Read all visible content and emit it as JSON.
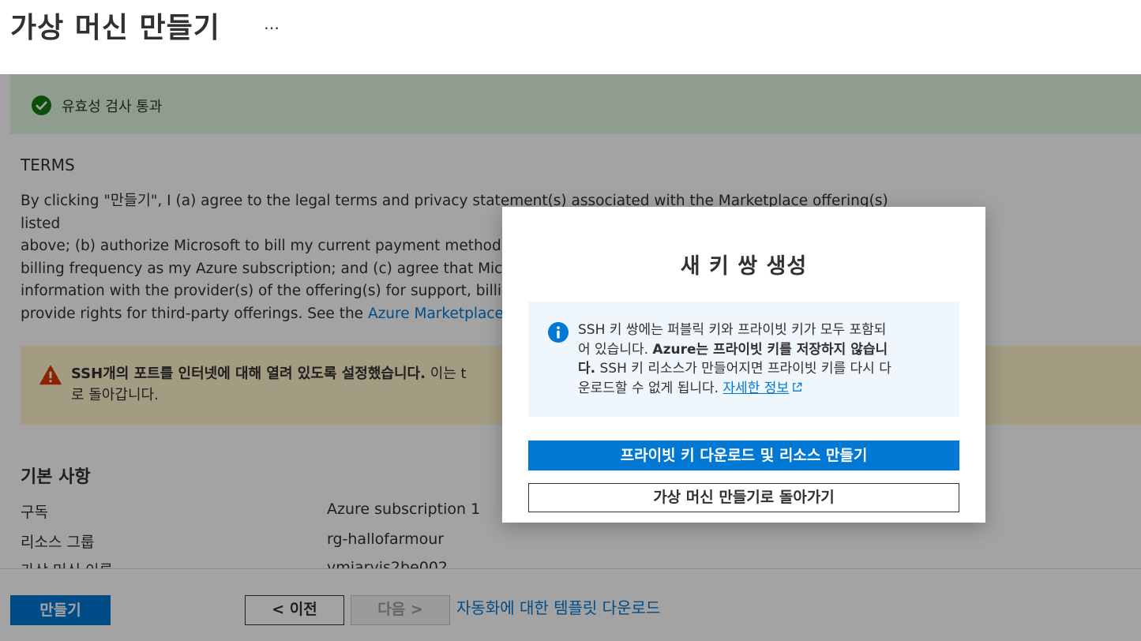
{
  "header": {
    "title": "가상 머신 만들기",
    "more_label": "…"
  },
  "validation": {
    "text": "유효성 검사 통과"
  },
  "terms": {
    "title": "TERMS",
    "line1": "By clicking \"만들기\", I (a) agree to the legal terms and privacy statement(s) associated with the Marketplace offering(s) listed",
    "line2": "above; (b) authorize Microsoft to bill my current payment method fo",
    "line3": "billing frequency as my Azure subscription; and (c) agree that Micros",
    "line4": "information with the provider(s) of the offering(s) for support, billing",
    "line5_prefix": "provide rights for third-party offerings. See the ",
    "line5_link": "Azure Marketplace Te"
  },
  "warning": {
    "bold_text": "SSH개의 포트를 인터넷에 대해 열려 있도록 설정했습니다.",
    "rest_text": "이는 t",
    "line2": "로 돌아갑니다."
  },
  "basics": {
    "title": "기본 사항",
    "rows": [
      {
        "label": "구독",
        "value": "Azure subscription 1"
      },
      {
        "label": "리소스 그룹",
        "value": "rg-hallofarmour"
      },
      {
        "label": "가상 머신 이름",
        "value": "vmjarvis2be002"
      }
    ]
  },
  "footer": {
    "create_label": "만들기",
    "prev_label": "< 이전",
    "next_label": "다음 >",
    "download_label": "자동화에 대한 템플릿 다운로드"
  },
  "dialog": {
    "title": "새 키 쌍 생성",
    "info_line1": "SSH 키 쌍에는 퍼블릭 키와 프라이빗 키가 모두 포함되",
    "info_line2_prefix": "어 있습니다. ",
    "info_line2_bold": "Azure는 프라이빗 키를 저장하지 않습니",
    "info_line3_bold": "다.",
    "info_line3_rest": " SSH 키 리소스가 만들어지면 프라이빗 키를 다시 다",
    "info_line4_prefix": "운로드할 수 없게 됩니다. ",
    "info_link": "자세한 정보",
    "primary_button": "프라이빗 키 다운로드 및 리소스 만들기",
    "secondary_button": "가상 머신 만들기로 돌아가기"
  },
  "colors": {
    "accent": "#0078d4",
    "success": "#107c10",
    "warning": "#d83b01",
    "info_bg": "#eff6fc"
  }
}
